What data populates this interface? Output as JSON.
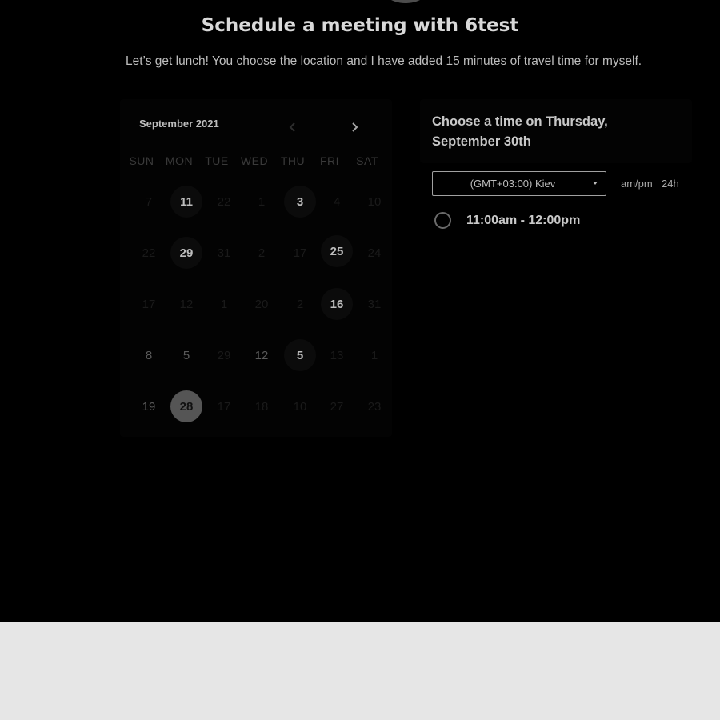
{
  "header": {
    "title": "Schedule a meeting with 6test",
    "description": "Let’s get lunch! You choose the location and I have added 15 minutes of travel time for myself."
  },
  "calendar": {
    "month_label": "September 2021",
    "prev_icon": "chevron-left-icon",
    "next_icon": "chevron-right-icon",
    "weekdays": [
      "SUN",
      "MON",
      "TUE",
      "WED",
      "THU",
      "FRI",
      "SAT"
    ],
    "rows": [
      [
        "7",
        "11",
        "22",
        "1",
        "3",
        "4",
        "10"
      ],
      [
        "22",
        "29",
        "31",
        "2",
        "17",
        "25",
        "24"
      ],
      [
        "17",
        "12",
        "1",
        "20",
        "2",
        "16",
        "31"
      ],
      [
        "8",
        "5",
        "29",
        "12",
        "5",
        "13",
        "1"
      ],
      [
        "19",
        "28",
        "17",
        "18",
        "10",
        "27",
        "23"
      ]
    ],
    "available": [
      "11",
      "3",
      "29",
      "25",
      "16",
      "5"
    ],
    "selected": "28"
  },
  "times": {
    "header": "Choose a time on Thursday, September 30th",
    "timezone": "(GMT+03:00) Kiev",
    "format_ampm": "am/pm",
    "format_24h": "24h",
    "slots": [
      "11:00am - 12:00pm"
    ]
  },
  "colors": {
    "background": "#000000",
    "footer": "#e6e6e6",
    "selected_day": "#555555"
  }
}
